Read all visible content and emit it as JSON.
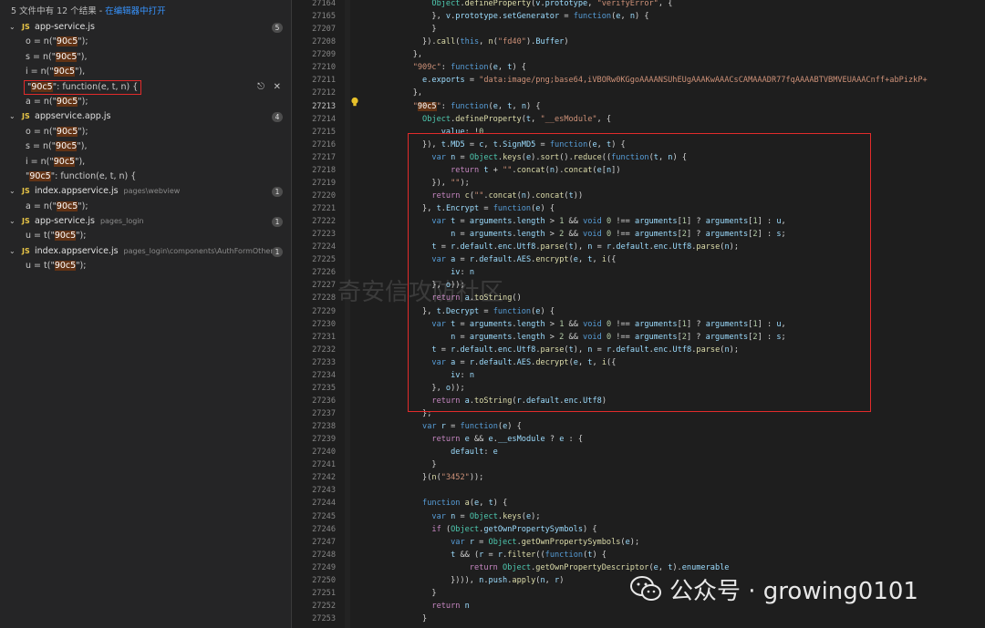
{
  "search": {
    "summary": "5 文件中有 12 个结果 - ",
    "open_in_editor": "在编辑器中打开",
    "files": [
      {
        "name": "app-service.js",
        "path": "",
        "count": "5",
        "matches": [
          {
            "pre": "o = n(\"",
            "hl": "90c5",
            "post": "\");"
          },
          {
            "pre": "s = n(\"",
            "hl": "90c5",
            "post": "\"),"
          },
          {
            "pre": "i = n(\"",
            "hl": "90c5",
            "post": "\"),"
          },
          {
            "pre": "\"",
            "hl": "90c5",
            "post": "\": function(e, t, n) {",
            "selected": true
          },
          {
            "pre": "a = n(\"",
            "hl": "90c5",
            "post": "\");"
          }
        ]
      },
      {
        "name": "appservice.app.js",
        "path": "",
        "count": "4",
        "matches": [
          {
            "pre": "o = n(\"",
            "hl": "90c5",
            "post": "\");"
          },
          {
            "pre": "s = n(\"",
            "hl": "90c5",
            "post": "\"),"
          },
          {
            "pre": "i = n(\"",
            "hl": "90c5",
            "post": "\"),"
          },
          {
            "pre": "\"",
            "hl": "90c5",
            "post": "\": function(e, t, n) {"
          }
        ]
      },
      {
        "name": "index.appservice.js",
        "path": "pages\\webview",
        "count": "1",
        "matches": [
          {
            "pre": "a = n(\"",
            "hl": "90c5",
            "post": "\");"
          }
        ]
      },
      {
        "name": "app-service.js",
        "path": "pages_login",
        "count": "1",
        "matches": [
          {
            "pre": "u = t(\"",
            "hl": "90c5",
            "post": "\");"
          }
        ]
      },
      {
        "name": "index.appservice.js",
        "path": "pages_login\\components\\AuthFormOther",
        "count": "1",
        "matches": [
          {
            "pre": "u = t(\"",
            "hl": "90c5",
            "post": "\");"
          }
        ]
      }
    ]
  },
  "editor": {
    "line_numbers": [
      "27164",
      "27165",
      "27207",
      "27208",
      "27209",
      "27210",
      "27211",
      "27212",
      "27213",
      "27214",
      "27215",
      "27216",
      "27217",
      "27218",
      "27219",
      "27220",
      "27221",
      "27222",
      "27223",
      "27224",
      "27225",
      "27226",
      "27227",
      "27228",
      "27229",
      "27230",
      "27231",
      "27232",
      "27233",
      "27234",
      "27235",
      "27236",
      "27237",
      "27238",
      "27239",
      "27240",
      "27241",
      "27242",
      "27243",
      "27244",
      "27245",
      "27246",
      "27247",
      "27248",
      "27249",
      "27250",
      "27251",
      "27252",
      "27253"
    ],
    "current_line": "27213"
  },
  "watermark": {
    "center_text": "奇安信攻防社区",
    "wechat": "公众号 · growing0101"
  },
  "colors": {
    "highlight_box": "#e22b2b",
    "match_highlight": "#623315",
    "link": "#3794ff"
  }
}
